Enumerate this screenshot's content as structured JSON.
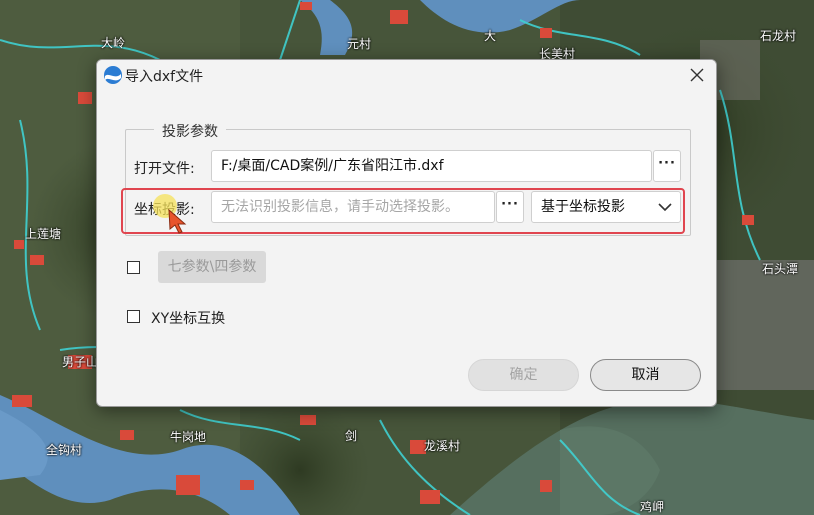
{
  "map": {
    "labels": [
      {
        "text": "大岭"
      },
      {
        "text": "元村"
      },
      {
        "text": "大"
      },
      {
        "text": "长美村"
      },
      {
        "text": "石龙村"
      },
      {
        "text": "上莲塘"
      },
      {
        "text": "石头潭"
      },
      {
        "text": "男子山"
      },
      {
        "text": "牛岗地"
      },
      {
        "text": "剑"
      },
      {
        "text": "龙溪村"
      },
      {
        "text": "全钩村"
      },
      {
        "text": "鸡岬"
      }
    ]
  },
  "dialog": {
    "title": "导入dxf文件",
    "group_title": "投影参数",
    "open_file": {
      "label": "打开文件:",
      "value": "F:/桌面/CAD案例/广东省阳江市.dxf",
      "browse": "···"
    },
    "projection": {
      "label": "坐标投影:",
      "placeholder": "无法识别投影信息，请手动选择投影。",
      "browse": "···",
      "select_value": "基于坐标投影"
    },
    "seven_param": {
      "checked": false,
      "button_label": "七参数\\四参数"
    },
    "xy_swap": {
      "checked": false,
      "label": "XY坐标互换"
    },
    "ok_label": "确定",
    "cancel_label": "取消"
  },
  "colors": {
    "highlight": "#e0454f",
    "dialog_bg": "#f3f3f3",
    "river": "#5f8fbd"
  }
}
